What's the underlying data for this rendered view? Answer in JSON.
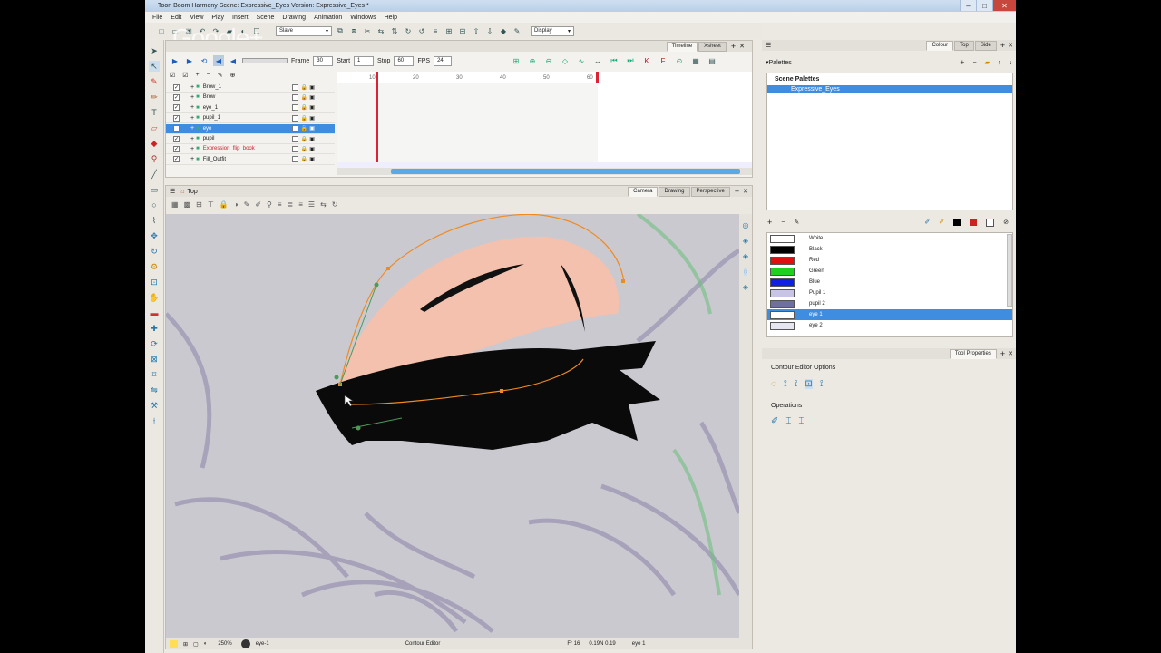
{
  "window": {
    "title": "Toon Boom Harmony Scene: Expressive_Eyes Version: Expressive_Eyes *",
    "minimize": "–",
    "maximize": "□",
    "close": "✕"
  },
  "menu": [
    "File",
    "Edit",
    "View",
    "Play",
    "Insert",
    "Scene",
    "Drawing",
    "Animation",
    "Windows",
    "Help"
  ],
  "watermark": "Google+",
  "toolbar": {
    "preset_select": "Slave",
    "display_select": "Display",
    "icons": [
      "new-icon",
      "open-icon",
      "save-icon",
      "undo-icon",
      "redo-icon"
    ]
  },
  "left_tools": [
    "select-icon",
    "contour-editor-icon",
    "brush-icon",
    "pencil-icon",
    "text-icon",
    "eraser-icon",
    "paint-icon",
    "dropper-icon",
    "line-icon",
    "rectangle-icon",
    "ellipse-icon",
    "polyline-icon",
    "pivot-icon",
    "rotate-icon",
    "morph-icon",
    "zoom-icon",
    "hand-icon",
    "cutter-icon",
    "smooth-icon",
    "perspective-icon",
    "envelope-icon",
    "reposition-icon",
    "flip-icon",
    "hammer-icon",
    "pin-icon"
  ],
  "timeline": {
    "tabs": [
      "Timeline",
      "Xsheet"
    ],
    "frame_label": "Frame",
    "frame_value": "30",
    "start_label": "Start",
    "start_value": "1",
    "stop_label": "Stop",
    "stop_value": "60",
    "fps_label": "FPS",
    "fps_value": "24",
    "ruler": [
      "10",
      "20",
      "30",
      "40",
      "50",
      "60"
    ],
    "layers": [
      {
        "name": "Brow_1",
        "active": false,
        "red": false
      },
      {
        "name": "Brow",
        "active": false,
        "red": false
      },
      {
        "name": "eye_1",
        "active": false,
        "red": false
      },
      {
        "name": "pupil_1",
        "active": false,
        "red": false
      },
      {
        "name": "eye",
        "active": true,
        "red": false
      },
      {
        "name": "pupil",
        "active": false,
        "red": false
      },
      {
        "name": "Expression_flip_book",
        "active": false,
        "red": true
      },
      {
        "name": "Fill_Outfit",
        "active": false,
        "red": false
      }
    ]
  },
  "viewport": {
    "title": "Top",
    "tabs": [
      "Camera",
      "Drawing",
      "Perspective"
    ],
    "status": {
      "zoom": "250%",
      "drawing": "eye-1",
      "tool": "Contour Editor",
      "frame": "Fr 16",
      "coords": "0.19N 0.19",
      "layer": "eye 1"
    }
  },
  "right": {
    "tabs": [
      "Colour",
      "Top",
      "Side"
    ],
    "palettes_label": "Palettes",
    "scene_palettes_label": "Scene Palettes",
    "palette_item": "Expressive_Eyes",
    "colors": [
      {
        "name": "White",
        "hex": "#ffffff"
      },
      {
        "name": "Black",
        "hex": "#000000"
      },
      {
        "name": "Red",
        "hex": "#e01010"
      },
      {
        "name": "Green",
        "hex": "#20d020"
      },
      {
        "name": "Blue",
        "hex": "#1020e0"
      },
      {
        "name": "Pupil 1",
        "hex": "#c8c4e8"
      },
      {
        "name": "pupil 2",
        "hex": "#7070a0"
      },
      {
        "name": "eye 1",
        "hex": "#ffffff"
      },
      {
        "name": "eye 2",
        "hex": "#e6e6f0"
      }
    ],
    "tool_properties_tab": "Tool Properties",
    "contour_options_label": "Contour Editor Options",
    "operations_label": "Operations"
  }
}
